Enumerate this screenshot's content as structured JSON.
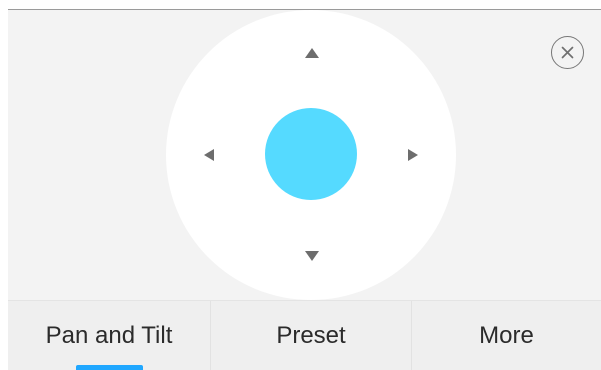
{
  "pan_tilt": {
    "joystick_color": "#55daff",
    "controls": {
      "up_icon": "triangle-up",
      "down_icon": "triangle-down",
      "left_icon": "triangle-left",
      "right_icon": "triangle-right",
      "close_icon": "close-circle"
    }
  },
  "tabs": {
    "items": [
      {
        "label": "Pan and Tilt"
      },
      {
        "label": "Preset"
      },
      {
        "label": "More"
      }
    ],
    "active_index": 0,
    "accent_color": "#20a7ff"
  }
}
